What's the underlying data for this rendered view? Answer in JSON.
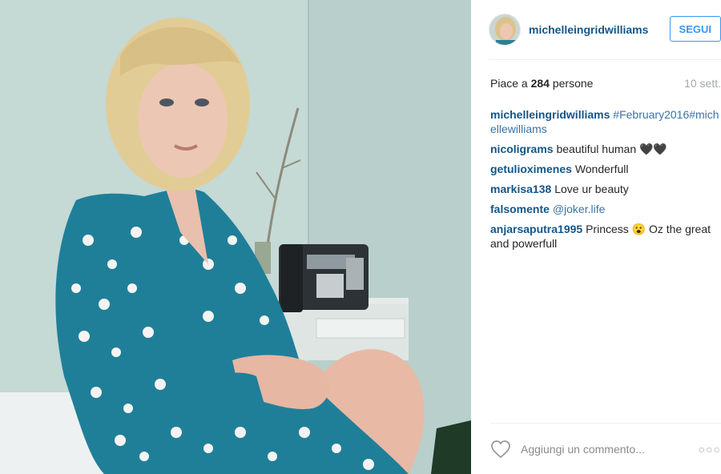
{
  "post": {
    "image_alt": "Woman with blonde bob wearing a blue polka-dot dress, seated by a desk phone"
  },
  "header": {
    "username": "michelleingridwilliams",
    "follow_label": "SEGUI"
  },
  "stats": {
    "likes_prefix": "Piace a ",
    "likes_count": "284",
    "likes_suffix": " persone",
    "time": "10 sett."
  },
  "caption": {
    "user": "michelleingridwilliams",
    "tags": "#February2016#michellewilliams"
  },
  "comments": [
    {
      "user": "nicoligrams",
      "text": "beautiful human 🖤🖤"
    },
    {
      "user": "getulioximenes",
      "text": "Wonderfull"
    },
    {
      "user": "markisa138",
      "text": "Love ur beauty"
    },
    {
      "user": "falsomente",
      "mention": "@joker.life"
    },
    {
      "user": "anjarsaputra1995",
      "text": "Princess 😮 Oz the great and powerfull"
    }
  ],
  "footer": {
    "comment_placeholder": "Aggiungi un commento...",
    "more_label": "○○○"
  },
  "colors": {
    "link_blue": "#125688",
    "tag_blue": "#3b73a6",
    "button_blue": "#3897f0",
    "muted": "#a5a7aa"
  },
  "icons": [
    "heart-icon",
    "more-options-icon",
    "avatar"
  ]
}
